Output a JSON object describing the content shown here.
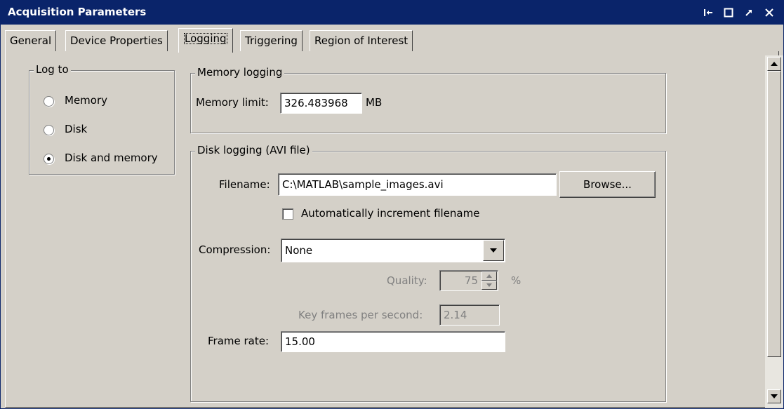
{
  "window": {
    "title": "Acquisition Parameters",
    "controls": [
      "dock-icon",
      "maximize-icon",
      "undock-icon",
      "close-icon"
    ]
  },
  "tabs": [
    {
      "label": "General",
      "active": false
    },
    {
      "label": "Device Properties",
      "active": false
    },
    {
      "label": "Logging",
      "active": true
    },
    {
      "label": "Triggering",
      "active": false
    },
    {
      "label": "Region of Interest",
      "active": false
    }
  ],
  "log_to": {
    "title": "Log to",
    "options": [
      {
        "label": "Memory",
        "selected": false
      },
      {
        "label": "Disk",
        "selected": false
      },
      {
        "label": "Disk and memory",
        "selected": true
      }
    ]
  },
  "memory_logging": {
    "title": "Memory logging",
    "limit_label": "Memory limit:",
    "limit_value": "326.483968",
    "limit_unit": "MB"
  },
  "disk_logging": {
    "title": "Disk logging (AVI file)",
    "filename_label": "Filename:",
    "filename_value": "C:\\MATLAB\\sample_images.avi",
    "browse_label": "Browse...",
    "auto_increment_label": "Automatically increment filename",
    "auto_increment_checked": false,
    "compression_label": "Compression:",
    "compression_value": "None",
    "quality_label": "Quality:",
    "quality_value": "75",
    "quality_unit": "%",
    "keyframes_label": "Key frames per second:",
    "keyframes_value": "2.14",
    "framerate_label": "Frame rate:",
    "framerate_value": "15.00"
  },
  "colors": {
    "titlebar": "#0a246a",
    "window_bg": "#d4d0c8",
    "disabled_text": "#808080"
  }
}
